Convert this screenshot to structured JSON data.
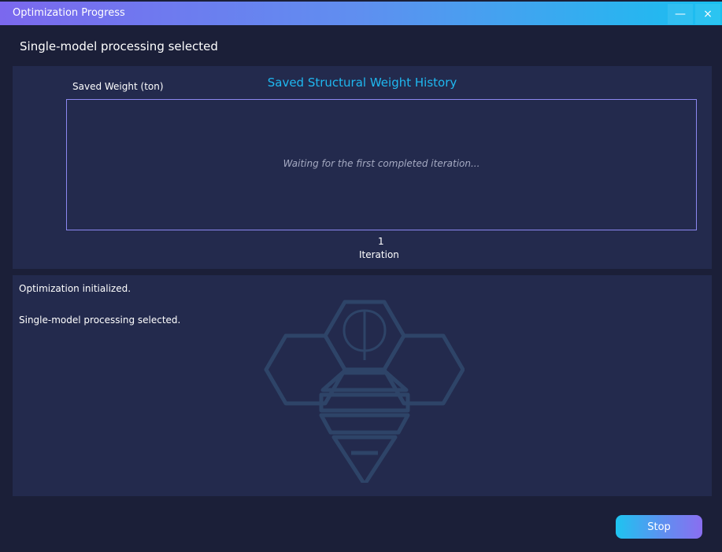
{
  "window": {
    "title": "Optimization Progress",
    "minimize_label": "—",
    "close_label": "×"
  },
  "status": "Single-model processing selected",
  "chart_data": {
    "type": "line",
    "title": "Saved Structural Weight History",
    "ylabel": "Saved Weight (ton)",
    "xlabel": "Iteration",
    "x_ticks": [
      "1"
    ],
    "series": [],
    "placeholder": "Waiting for the first completed iteration..."
  },
  "log": [
    "Optimization initialized.",
    "Single-model processing selected."
  ],
  "watermark_icon": "bee-hexagon-logo-icon",
  "actions": {
    "stop_label": "Stop"
  },
  "colors": {
    "accent": "#1fb8f0",
    "background": "#1b1f38",
    "panel": "#232a4d",
    "plot_border": "#8c88f0"
  }
}
